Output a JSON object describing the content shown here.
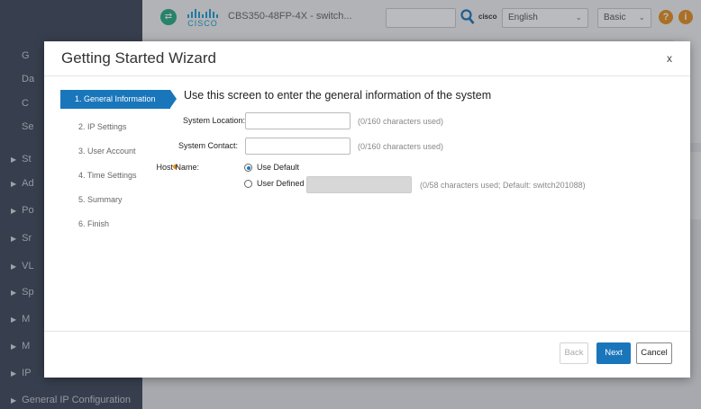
{
  "header": {
    "device_title": "CBS350-48FP-4X - switch...",
    "cisco_wordmark": "CISCO",
    "cisco_small": "cisco",
    "language": "English",
    "mode": "Basic",
    "help_glyph": "?",
    "info_glyph": "i"
  },
  "sidebar": {
    "items": [
      {
        "label": "G",
        "plain": true
      },
      {
        "label": "Da",
        "plain": true
      },
      {
        "label": "C",
        "plain": true
      },
      {
        "label": "Se",
        "plain": true
      },
      {
        "label": "St",
        "plain": false
      },
      {
        "label": "Ad",
        "plain": false
      },
      {
        "label": "Po",
        "plain": false
      },
      {
        "label": "Sr",
        "plain": false
      },
      {
        "label": "VL",
        "plain": false
      },
      {
        "label": "Sp",
        "plain": false
      },
      {
        "label": "M",
        "plain": false
      },
      {
        "label": "M",
        "plain": false
      },
      {
        "label": "IP",
        "plain": false
      },
      {
        "label": "General IP Configuration",
        "plain": false
      }
    ]
  },
  "wizard": {
    "title": "Getting Started Wizard",
    "close_label": "x",
    "steps": [
      "1. General Information",
      "2. IP Settings",
      "3. User Account",
      "4. Time Settings",
      "5. Summary",
      "6. Finish"
    ],
    "active_step": 0,
    "heading": "Use this screen to enter the general information of the system",
    "system_location": {
      "label": "System Location:",
      "value": "",
      "hint": "(0/160 characters used)"
    },
    "system_contact": {
      "label": "System Contact:",
      "value": "",
      "hint": "(0/160 characters used)"
    },
    "host_name": {
      "label": "Host Name:",
      "option_default": "Use Default",
      "option_user": "User Defined",
      "selected": "Use Default",
      "value": "",
      "hint": "(0/58 characters used; Default: switch201088)"
    },
    "buttons": {
      "back": "Back",
      "next": "Next",
      "cancel": "Cancel"
    }
  },
  "colors": {
    "accent": "#1a76bb",
    "sidebar": "#3f4759",
    "required": "#e8911f"
  }
}
